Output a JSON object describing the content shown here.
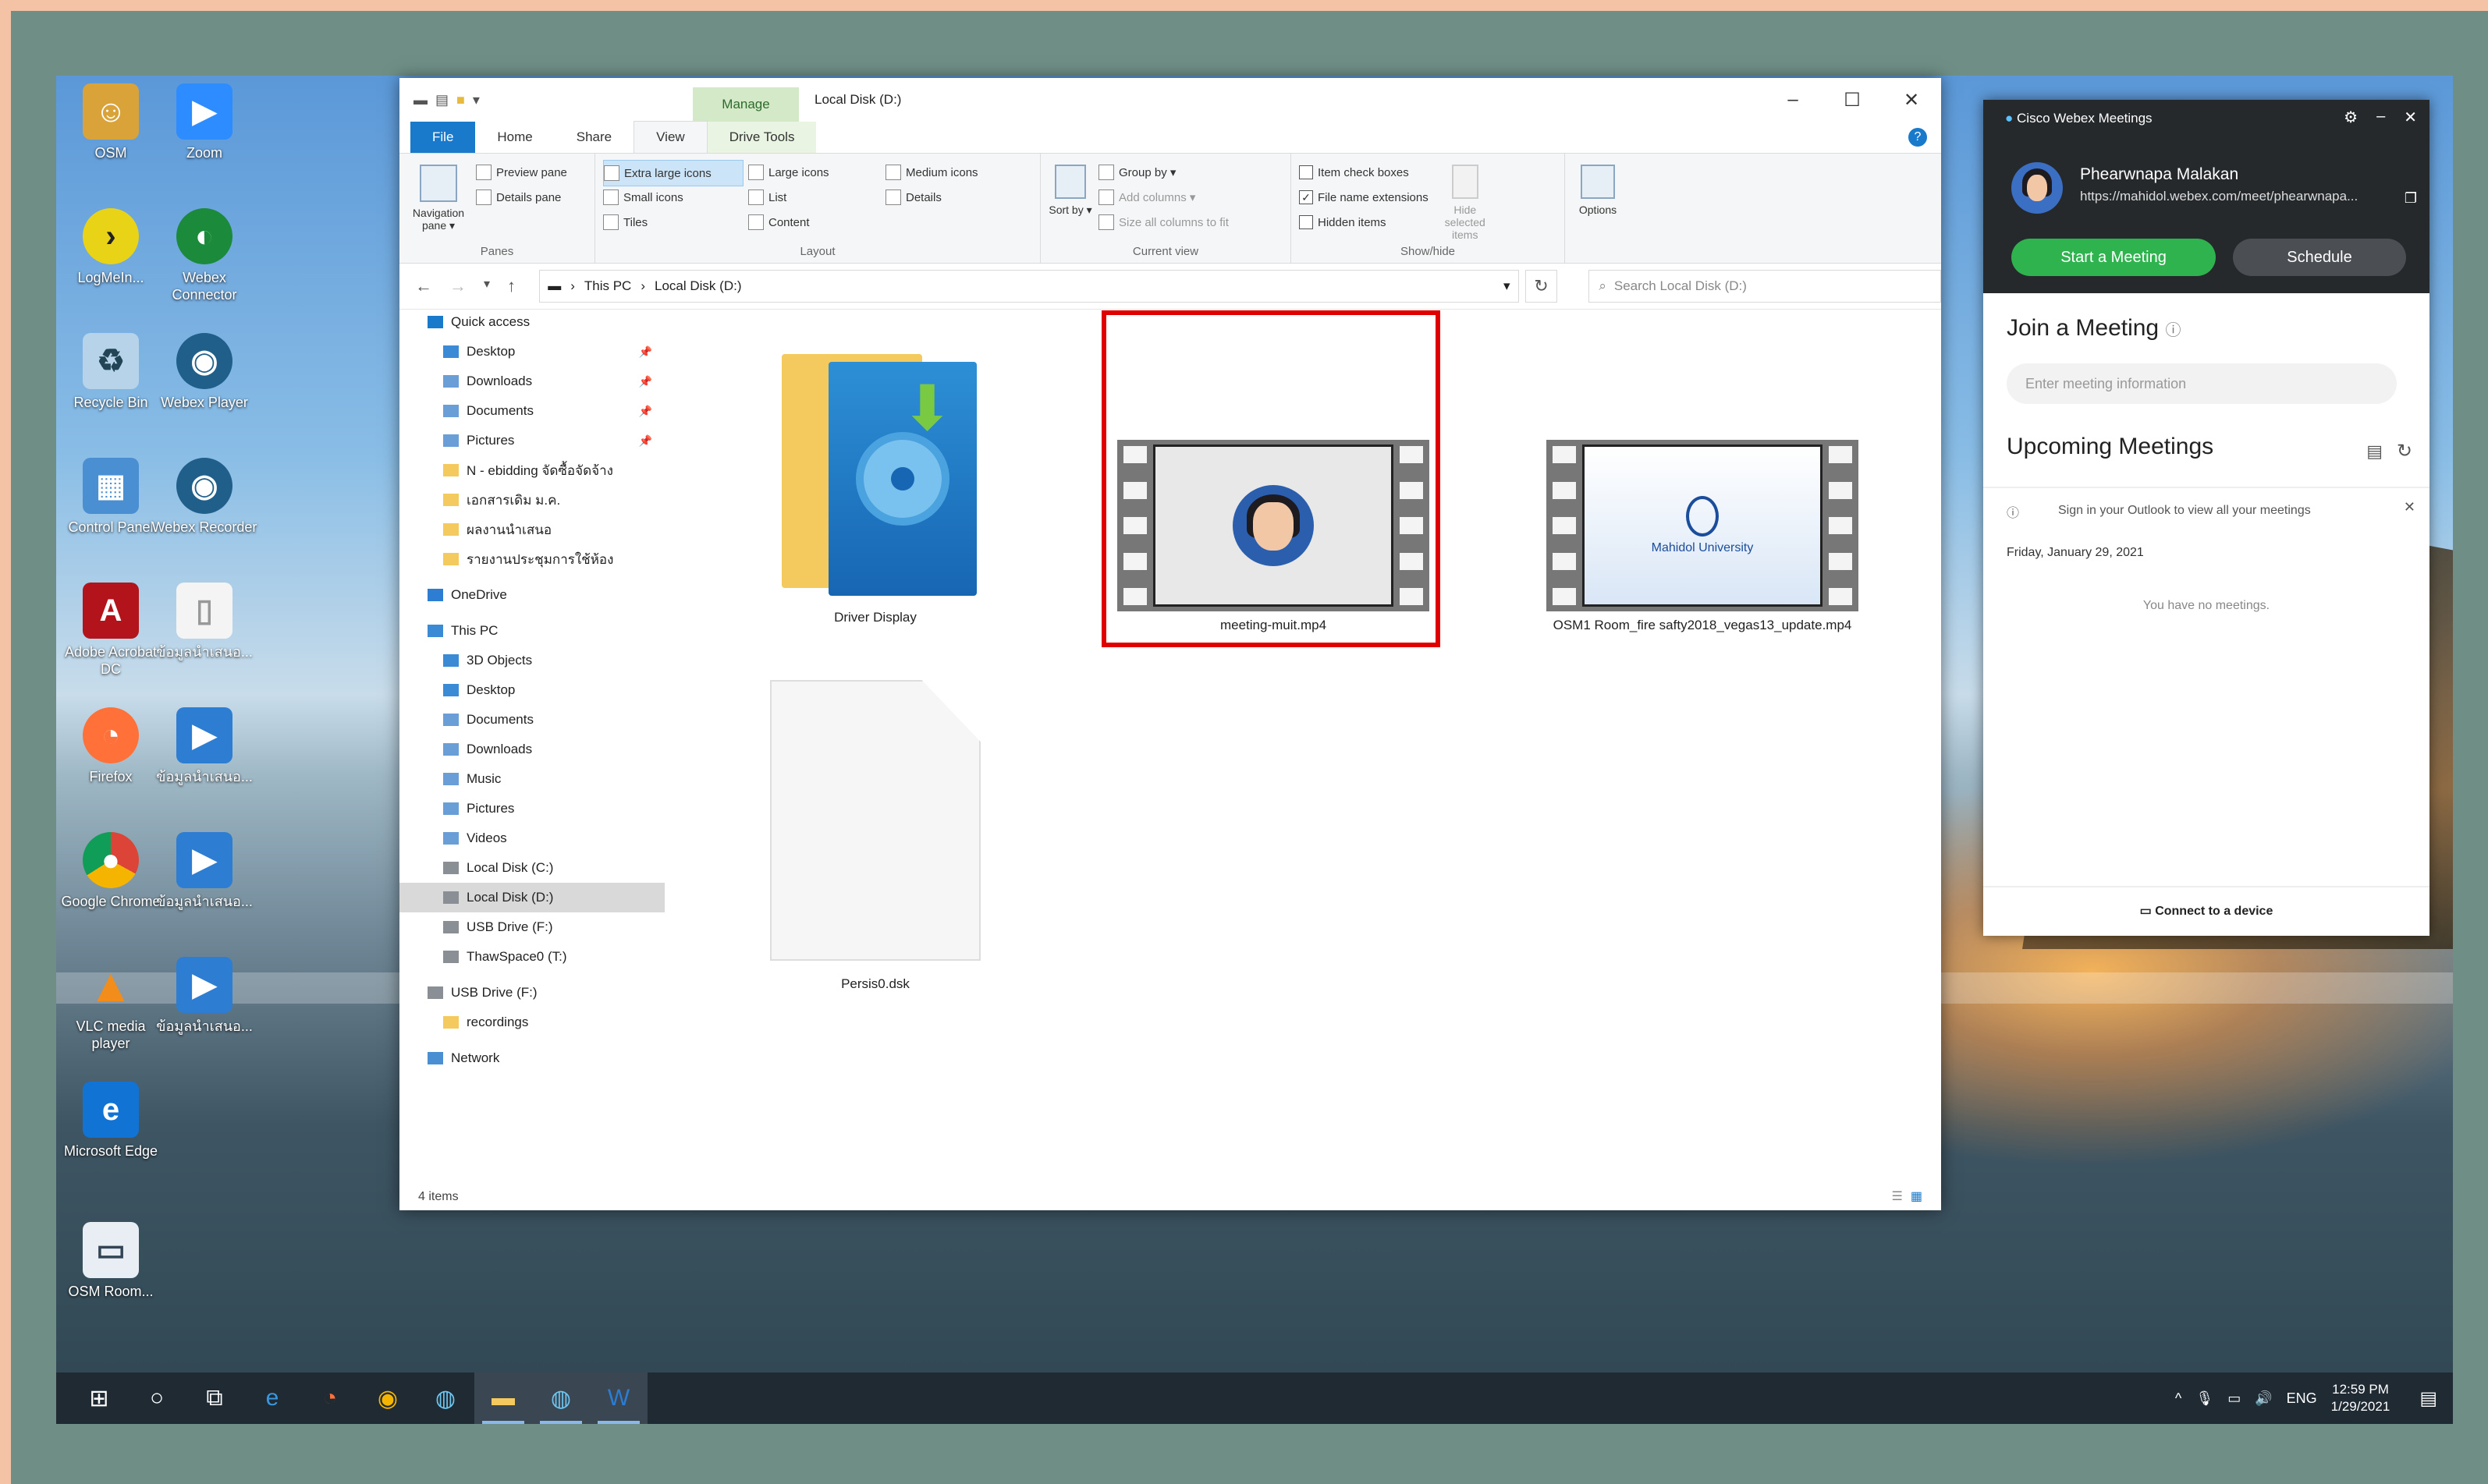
{
  "desktop": {
    "icons": [
      {
        "label": "OSM",
        "name": "osm"
      },
      {
        "label": "Zoom",
        "name": "zoom"
      },
      {
        "label": "LogMeIn...",
        "name": "logmein"
      },
      {
        "label": "Webex Connector",
        "name": "webex-connector"
      },
      {
        "label": "Recycle Bin",
        "name": "recycle-bin"
      },
      {
        "label": "Webex Player",
        "name": "webex-player"
      },
      {
        "label": "Control Panel",
        "name": "control-panel"
      },
      {
        "label": "Webex Recorder",
        "name": "webex-recorder"
      },
      {
        "label": "Adobe Acrobat DC",
        "name": "adobe"
      },
      {
        "label": "ข้อมูลนำเสนอ...",
        "name": "file-1"
      },
      {
        "label": "Firefox",
        "name": "firefox"
      },
      {
        "label": "ข้อมูลนำเสนอ...",
        "name": "file-2"
      },
      {
        "label": "Google Chrome",
        "name": "chrome"
      },
      {
        "label": "ข้อมูลนำเสนอ...",
        "name": "file-3"
      },
      {
        "label": "VLC media player",
        "name": "vlc"
      },
      {
        "label": "ข้อมูลนำเสนอ...",
        "name": "file-4"
      },
      {
        "label": "Microsoft Edge",
        "name": "edge"
      },
      {
        "label": "OSM Room...",
        "name": "osm-room"
      }
    ]
  },
  "explorer": {
    "manage_tab": "Manage",
    "title": "Local Disk (D:)",
    "tabs": {
      "file": "File",
      "home": "Home",
      "share": "Share",
      "view": "View",
      "drive_tools": "Drive Tools"
    },
    "ribbon": {
      "panes": {
        "navigation": "Navigation pane ▾",
        "preview": "Preview pane",
        "details": "Details pane",
        "group": "Panes"
      },
      "layout": {
        "extra_large": "Extra large icons",
        "large": "Large icons",
        "medium": "Medium icons",
        "small": "Small icons",
        "list": "List",
        "details": "Details",
        "tiles": "Tiles",
        "content": "Content",
        "group": "Layout"
      },
      "current_view": {
        "sort": "Sort by ▾",
        "group_by": "Group by ▾",
        "add_columns": "Add columns ▾",
        "size_cols": "Size all columns to fit",
        "group": "Current view"
      },
      "show_hide": {
        "item_check": "Item check boxes",
        "ext": "File name extensions",
        "hidden": "Hidden items",
        "hide_selected": "Hide selected items",
        "group": "Show/hide"
      },
      "options": "Options"
    },
    "address": {
      "this_pc": "This PC",
      "drive": "Local Disk (D:)",
      "search_placeholder": "Search Local Disk (D:)"
    },
    "nav": [
      {
        "label": "Quick access",
        "indent": 0,
        "pin": false
      },
      {
        "label": "Desktop",
        "indent": 1,
        "pin": true
      },
      {
        "label": "Downloads",
        "indent": 1,
        "pin": true
      },
      {
        "label": "Documents",
        "indent": 1,
        "pin": true
      },
      {
        "label": "Pictures",
        "indent": 1,
        "pin": true
      },
      {
        "label": "N - ebidding จัดซื้อจัดจ้าง",
        "indent": 1,
        "pin": false
      },
      {
        "label": "เอกสารเดิม ม.ค.",
        "indent": 1,
        "pin": false
      },
      {
        "label": "ผลงานนำเสนอ",
        "indent": 1,
        "pin": false
      },
      {
        "label": "รายงานประชุมการใช้ห้อง",
        "indent": 1,
        "pin": false
      },
      {
        "label": "OneDrive",
        "indent": 0,
        "pin": false
      },
      {
        "label": "This PC",
        "indent": 0,
        "pin": false
      },
      {
        "label": "3D Objects",
        "indent": 1,
        "pin": false
      },
      {
        "label": "Desktop",
        "indent": 1,
        "pin": false
      },
      {
        "label": "Documents",
        "indent": 1,
        "pin": false
      },
      {
        "label": "Downloads",
        "indent": 1,
        "pin": false
      },
      {
        "label": "Music",
        "indent": 1,
        "pin": false
      },
      {
        "label": "Pictures",
        "indent": 1,
        "pin": false
      },
      {
        "label": "Videos",
        "indent": 1,
        "pin": false
      },
      {
        "label": "Local Disk (C:)",
        "indent": 1,
        "pin": false
      },
      {
        "label": "Local Disk (D:)",
        "indent": 1,
        "pin": false,
        "selected": true
      },
      {
        "label": "USB Drive (F:)",
        "indent": 1,
        "pin": false
      },
      {
        "label": "ThawSpace0 (T:)",
        "indent": 1,
        "pin": false
      },
      {
        "label": "USB Drive (F:)",
        "indent": 0,
        "pin": false
      },
      {
        "label": "recordings",
        "indent": 1,
        "pin": false
      },
      {
        "label": "Network",
        "indent": 0,
        "pin": false
      }
    ],
    "files": [
      {
        "label": "Driver Display",
        "kind": "folder"
      },
      {
        "label": "meeting-muit.mp4",
        "kind": "video-avatar"
      },
      {
        "label": "OSM1 Room_fire safty2018_vegas13_update.mp4",
        "kind": "video-mahidol"
      },
      {
        "label": "Persis0.dsk",
        "kind": "blank"
      }
    ],
    "thumb_text": {
      "university": "Mahidol University"
    },
    "status": "4 items"
  },
  "webex": {
    "title": "Cisco Webex Meetings",
    "name": "Phearwnapa Malakan",
    "url": "https://mahidol.webex.com/meet/phearwnapa...",
    "start": "Start a Meeting",
    "schedule": "Schedule",
    "join_title": "Join a Meeting",
    "join_placeholder": "Enter meeting information",
    "upcoming_title": "Upcoming Meetings",
    "outlook_note": "Sign in your Outlook to view all your meetings",
    "date": "Friday, January 29, 2021",
    "no_meetings": "You have no meetings.",
    "connect": "Connect to a device"
  },
  "taskbar": {
    "lang": "ENG",
    "time": "12:59 PM",
    "date": "1/29/2021"
  },
  "colors": {
    "accent": "#1979ca",
    "webex_green": "#2fb34f",
    "highlight": "#e00000"
  }
}
